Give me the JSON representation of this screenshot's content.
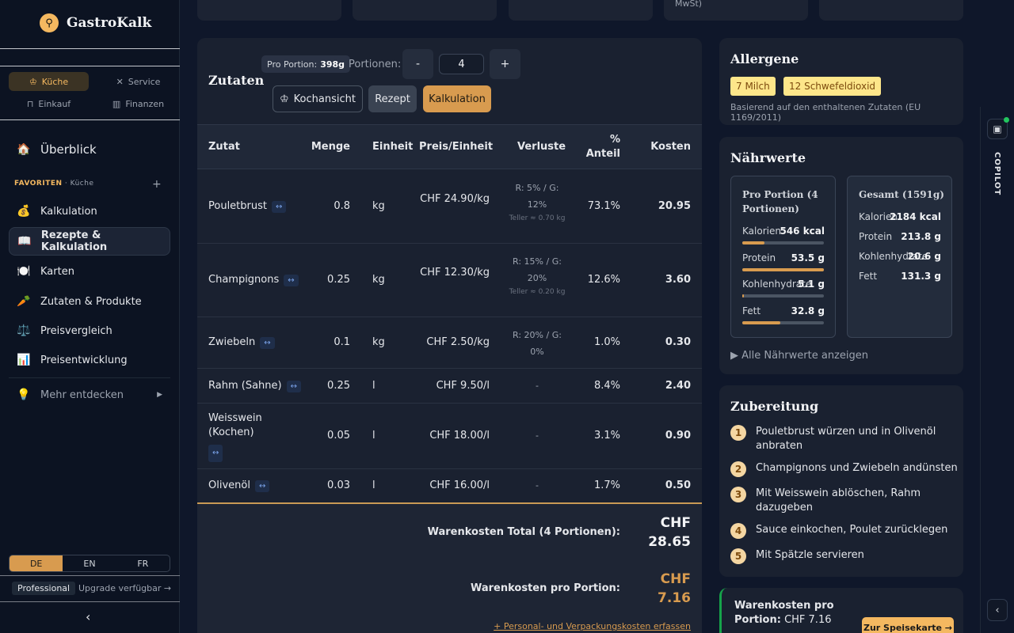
{
  "app": {
    "name": "GastroKalk"
  },
  "modes": [
    {
      "label": "Küche"
    },
    {
      "label": "Service"
    },
    {
      "label": "Einkauf"
    },
    {
      "label": "Finanzen"
    }
  ],
  "nav": {
    "overview": "Überblick",
    "favorites_label": "FAVORITEN",
    "favorites_context": "· Küche",
    "favorites_add": "+",
    "items": [
      {
        "label": "Kalkulation",
        "icon": "💰"
      },
      {
        "label": "Rezepte & Kalkulation",
        "icon": "📖"
      },
      {
        "label": "Karten",
        "icon": "🍽️"
      },
      {
        "label": "Zutaten & Produkte",
        "icon": "🥕"
      },
      {
        "label": "Preisvergleich",
        "icon": "⚖️"
      },
      {
        "label": "Preisentwicklung",
        "icon": "📊"
      }
    ],
    "more": "Mehr entdecken",
    "languages": [
      "DE",
      "EN",
      "FR"
    ],
    "plan": "Professional",
    "upgrade": "Upgrade verfügbar →"
  },
  "top": {
    "partial_text": "MwSt)"
  },
  "recipe": {
    "title": "Zutaten",
    "portion_label": "Pro Portion:",
    "portion_value": "398g",
    "portions_label": "Portionen:",
    "minus": "-",
    "plus": "+",
    "portions_value": "4",
    "views": [
      "Kochansicht",
      "Rezept",
      "Kalkulation"
    ],
    "columns": [
      "Zutat",
      "Menge",
      "Einheit",
      "Preis/Einheit",
      "Verluste",
      "% Anteil",
      "Kosten"
    ],
    "swap_symbol": "↔",
    "rows": [
      {
        "name": "Pouletbrust",
        "qty": "0.8",
        "unit": "kg",
        "price": "CHF 24.90/kg",
        "loss": "R: 5% / G: 12%",
        "loss_note": "Teller ≈ 0.70 kg",
        "share": "73.1%",
        "cost": "20.95"
      },
      {
        "name": "Champignons",
        "qty": "0.25",
        "unit": "kg",
        "price": "CHF 12.30/kg",
        "loss": "R: 15% / G: 20%",
        "loss_note": "Teller ≈ 0.20 kg",
        "share": "12.6%",
        "cost": "3.60"
      },
      {
        "name": "Zwiebeln",
        "qty": "0.1",
        "unit": "kg",
        "price": "CHF 2.50/kg",
        "loss": "R: 20% / G: 0%",
        "loss_note": "",
        "share": "1.0%",
        "cost": "0.30"
      },
      {
        "name": "Rahm (Sahne)",
        "qty": "0.25",
        "unit": "l",
        "price": "CHF 9.50/l",
        "loss": "-",
        "loss_note": "",
        "share": "8.4%",
        "cost": "2.40"
      },
      {
        "name": "Weisswein (Kochen)",
        "qty": "0.05",
        "unit": "l",
        "price": "CHF 18.00/l",
        "loss": "-",
        "loss_note": "",
        "share": "3.1%",
        "cost": "0.90"
      },
      {
        "name": "Olivenöl",
        "qty": "0.03",
        "unit": "l",
        "price": "CHF 16.00/l",
        "loss": "-",
        "loss_note": "",
        "share": "1.7%",
        "cost": "0.50"
      }
    ],
    "total_label": "Warenkosten Total (4 Portionen):",
    "total_currency": "CHF",
    "total_value": "28.65",
    "per_portion_label": "Warenkosten pro Portion:",
    "per_portion_currency": "CHF",
    "per_portion_value": "7.16",
    "add_costs": "+ Personal- und Verpackungskosten erfassen"
  },
  "allergens": {
    "title": "Allergene",
    "chips": [
      "7 Milch",
      "12 Schwefeldioxid"
    ],
    "note": "Basierend auf den enthaltenen Zutaten (EU 1169/2011)"
  },
  "nutrition": {
    "title": "Nährwerte",
    "portion_title": "Pro Portion (4 Portionen)",
    "total_title": "Gesamt (1591g)",
    "portion": [
      {
        "label": "Kalorien",
        "value": "546 kcal",
        "fill": 0.27
      },
      {
        "label": "Protein",
        "value": "53.5 g",
        "fill": 1.0
      },
      {
        "label": "Kohlenhydrate",
        "value": "5.1 g",
        "fill": 0.02
      },
      {
        "label": "Fett",
        "value": "32.8 g",
        "fill": 0.47
      }
    ],
    "total": [
      {
        "label": "Kalorien",
        "value": "2184 kcal"
      },
      {
        "label": "Protein",
        "value": "213.8 g"
      },
      {
        "label": "Kohlenhydrate",
        "value": "20.6 g"
      },
      {
        "label": "Fett",
        "value": "131.3 g"
      }
    ],
    "more": "▶ Alle Nährwerte anzeigen"
  },
  "preparation": {
    "title": "Zubereitung",
    "steps": [
      {
        "n": "1",
        "text": "Pouletbrust würzen und in Olivenöl anbraten"
      },
      {
        "n": "2",
        "text": "Champignons und Zwiebeln andünsten"
      },
      {
        "n": "3",
        "text": "Mit Weisswein ablöschen, Rahm dazugeben"
      },
      {
        "n": "4",
        "text": "Sauce einkochen, Poulet zurücklegen"
      },
      {
        "n": "5",
        "text": "Mit Spätzle servieren"
      }
    ]
  },
  "costcard": {
    "label": "Warenkosten pro Portion:",
    "value": "CHF 7.16",
    "button": "Zur Speisekarte →"
  },
  "copilot": {
    "label": "COPILOT"
  },
  "colors": {
    "accent": "#d89b4f",
    "background": "#0f172a",
    "panel": "#1a2130",
    "success": "#16a34a"
  }
}
